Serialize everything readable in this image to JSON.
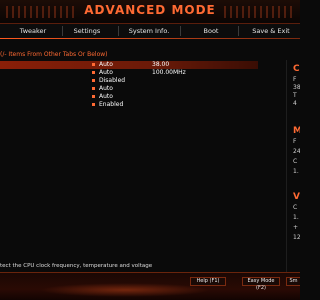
{
  "header": {
    "title": "ADVANCED MODE"
  },
  "tabs": [
    {
      "label": "Tweaker"
    },
    {
      "label": "Settings"
    },
    {
      "label": "System Info."
    },
    {
      "label": "Boot"
    },
    {
      "label": "Save & Exit"
    }
  ],
  "main": {
    "section_header": "(/- Items From Other Tabs Or Below)",
    "rows": [
      {
        "value": "Auto",
        "value2": "38.00",
        "selected": true
      },
      {
        "value": "Auto",
        "value2": "100.00MHz"
      },
      {
        "value": "Disabled"
      },
      {
        "value": "Auto"
      },
      {
        "value": "Auto"
      },
      {
        "value": "Enabled"
      }
    ]
  },
  "side_panel": {
    "items": [
      {
        "kind": "head",
        "text": "C"
      },
      {
        "kind": "text",
        "text": "F"
      },
      {
        "kind": "text",
        "text": "38"
      },
      {
        "kind": "text",
        "text": "T"
      },
      {
        "kind": "text",
        "text": "4"
      },
      {
        "kind": "head",
        "text": "M"
      },
      {
        "kind": "text",
        "text": "F"
      },
      {
        "kind": "text",
        "text": "24"
      },
      {
        "kind": "text",
        "text": "C"
      },
      {
        "kind": "text",
        "text": "1."
      },
      {
        "kind": "head",
        "text": "V"
      },
      {
        "kind": "text",
        "text": "C"
      },
      {
        "kind": "text",
        "text": "1."
      },
      {
        "kind": "text",
        "text": "+"
      },
      {
        "kind": "text",
        "text": "12"
      }
    ]
  },
  "help_text": "tect the CPU clock frequency, temperature and voltage",
  "footer": {
    "buttons": [
      {
        "label": "Help (F1)"
      },
      {
        "label": "Easy Mode (F2)"
      },
      {
        "label": "Sm"
      }
    ]
  },
  "colors": {
    "accent": "#ff6a33",
    "selected_row": "#8a1f08",
    "background": "#0a0a0a"
  }
}
